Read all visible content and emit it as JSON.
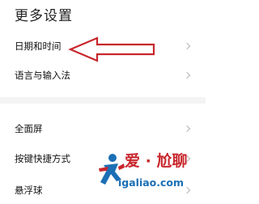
{
  "header": {
    "title": "更多设置"
  },
  "section1": {
    "items": [
      {
        "label": "日期和时间",
        "chevron": "chevron-right-icon"
      },
      {
        "label": "语言与输入法",
        "chevron": "chevron-right-icon"
      }
    ]
  },
  "section2": {
    "items": [
      {
        "label": "全面屏",
        "chevron": "chevron-right-icon"
      },
      {
        "label": "按键快捷方式",
        "chevron": "chevron-right-icon"
      },
      {
        "label": "悬浮球",
        "chevron": "chevron-right-icon"
      }
    ]
  },
  "annotation": {
    "icon": "red-arrow-left-icon",
    "color": "#c8272d"
  },
  "watermark": {
    "logo_text": "爱 · 尬聊",
    "domain": "igaliao.com",
    "colors": {
      "red": "#c8272d",
      "blue": "#1c6fb5"
    }
  },
  "colors": {
    "divider": "#f4f4f4",
    "chevron": "#b5b5b5",
    "text": "#111111"
  }
}
